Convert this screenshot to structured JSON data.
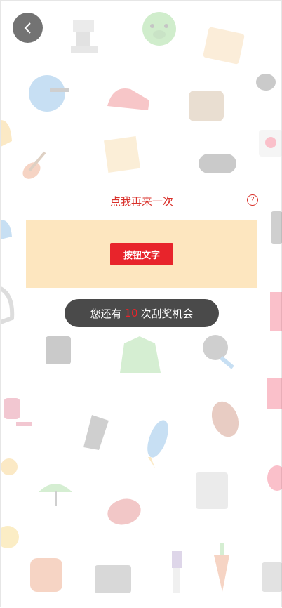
{
  "icons": {
    "back": "chevron-left-icon",
    "help": "question-circle-icon"
  },
  "retry": {
    "label": "点我再来一次",
    "help_glyph": "?"
  },
  "scratch_card": {
    "button_label": "按钮文字"
  },
  "chances": {
    "prefix": "您还有",
    "count": "10",
    "suffix": "次刮奖机会"
  },
  "colors": {
    "accent_red": "#e8242b",
    "panel_beige": "#fde6bf",
    "pill_dark": "#4a4a4a"
  }
}
